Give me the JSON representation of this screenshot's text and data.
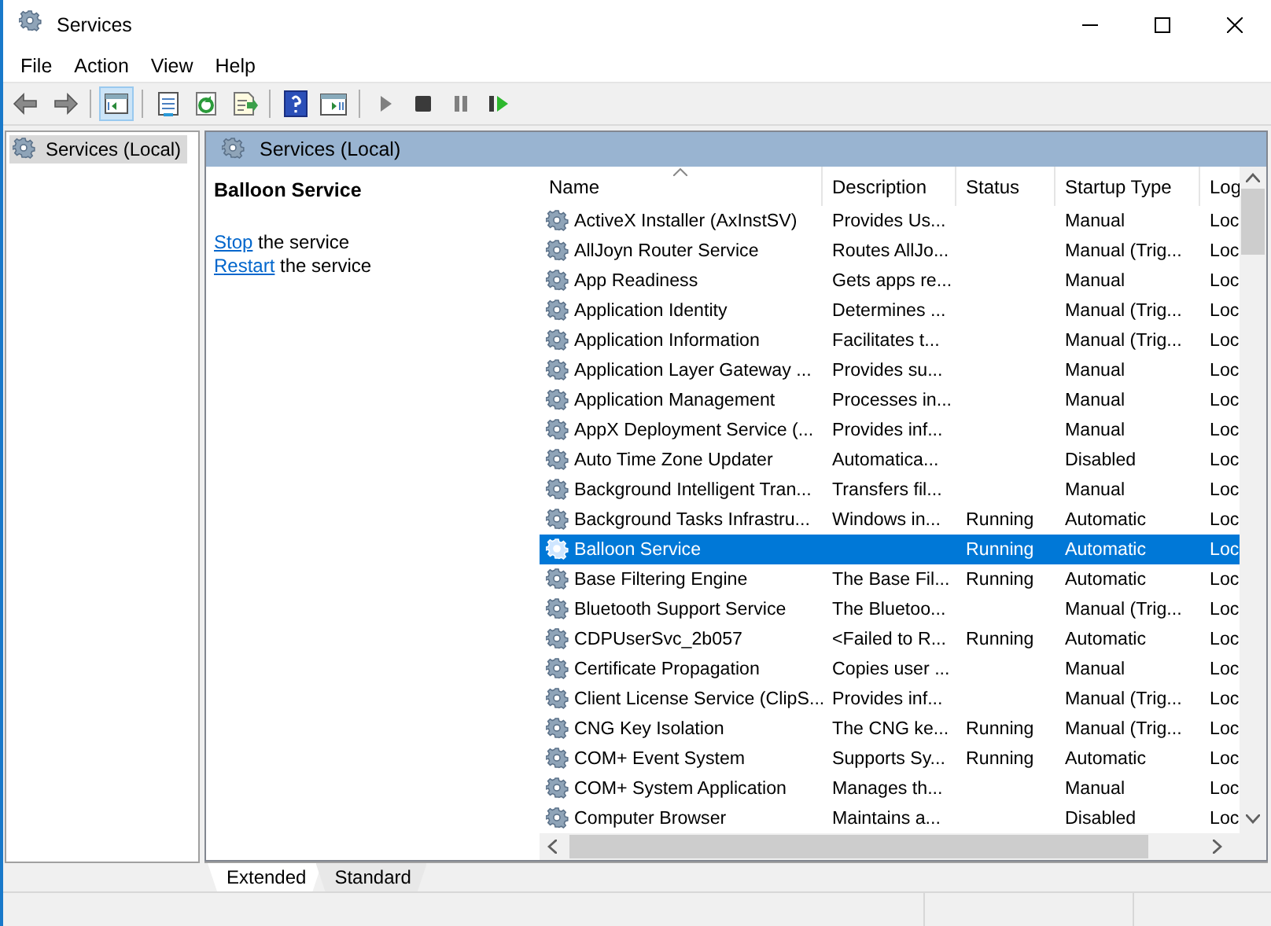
{
  "window": {
    "title": "Services"
  },
  "menu": [
    {
      "label": "File"
    },
    {
      "label": "Action"
    },
    {
      "label": "View"
    },
    {
      "label": "Help"
    }
  ],
  "toolbar": [
    {
      "kind": "back",
      "selected": false
    },
    {
      "kind": "forward",
      "selected": false
    },
    {
      "kind": "sep"
    },
    {
      "kind": "tree",
      "selected": true
    },
    {
      "kind": "sep"
    },
    {
      "kind": "properties",
      "selected": false
    },
    {
      "kind": "refresh",
      "selected": false
    },
    {
      "kind": "export",
      "selected": false
    },
    {
      "kind": "sep"
    },
    {
      "kind": "help",
      "selected": false
    },
    {
      "kind": "pane",
      "selected": false
    },
    {
      "kind": "sep"
    },
    {
      "kind": "play",
      "selected": false
    },
    {
      "kind": "stop",
      "selected": false
    },
    {
      "kind": "pause",
      "selected": false
    },
    {
      "kind": "resume",
      "selected": false
    }
  ],
  "tree": {
    "items": [
      {
        "label": "Services (Local)",
        "selected": true
      }
    ]
  },
  "panel": {
    "title": "Services (Local)"
  },
  "details": {
    "title": "Balloon Service",
    "actions": [
      {
        "link": "Stop",
        "text": "the service"
      },
      {
        "link": "Restart",
        "text": "the service"
      }
    ]
  },
  "table": {
    "columns": [
      "Name",
      "Description",
      "Status",
      "Startup Type",
      "Log"
    ],
    "rows": [
      {
        "name": "ActiveX Installer (AxInstSV)",
        "description": "Provides Us...",
        "startup": "Manual",
        "log": "Loc",
        "selected": false
      },
      {
        "name": "AllJoyn Router Service",
        "description": "Routes AllJo...",
        "startup": "Manual (Trig...",
        "log": "Loc",
        "selected": false
      },
      {
        "name": "App Readiness",
        "description": "Gets apps re...",
        "startup": "Manual",
        "log": "Loc",
        "selected": false
      },
      {
        "name": "Application Identity",
        "description": "Determines ...",
        "startup": "Manual (Trig...",
        "log": "Loc",
        "selected": false
      },
      {
        "name": "Application Information",
        "description": "Facilitates t...",
        "startup": "Manual (Trig...",
        "log": "Loc",
        "selected": false
      },
      {
        "name": "Application Layer Gateway ...",
        "description": "Provides su...",
        "startup": "Manual",
        "log": "Loc",
        "selected": false
      },
      {
        "name": "Application Management",
        "description": "Processes in...",
        "startup": "Manual",
        "log": "Loc",
        "selected": false
      },
      {
        "name": "AppX Deployment Service (...",
        "description": "Provides inf...",
        "startup": "Manual",
        "log": "Loc",
        "selected": false
      },
      {
        "name": "Auto Time Zone Updater",
        "description": "Automatica...",
        "startup": "Disabled",
        "log": "Loc",
        "selected": false
      },
      {
        "name": "Background Intelligent Tran...",
        "description": "Transfers fil...",
        "startup": "Manual",
        "log": "Loc",
        "selected": false
      },
      {
        "name": "Background Tasks Infrastru...",
        "description": "Windows in...",
        "status": "Running",
        "startup": "Automatic",
        "log": "Loc",
        "selected": false
      },
      {
        "name": "Balloon Service",
        "status": "Running",
        "startup": "Automatic",
        "log": "Loc",
        "selected": true
      },
      {
        "name": "Base Filtering Engine",
        "description": "The Base Fil...",
        "status": "Running",
        "startup": "Automatic",
        "log": "Loc",
        "selected": false
      },
      {
        "name": "Bluetooth Support Service",
        "description": "The Bluetoo...",
        "startup": "Manual (Trig...",
        "log": "Loc",
        "selected": false
      },
      {
        "name": "CDPUserSvc_2b057",
        "description": "<Failed to R...",
        "status": "Running",
        "startup": "Automatic",
        "log": "Loc",
        "selected": false
      },
      {
        "name": "Certificate Propagation",
        "description": "Copies user ...",
        "startup": "Manual",
        "log": "Loc",
        "selected": false
      },
      {
        "name": "Client License Service (ClipS...",
        "description": "Provides inf...",
        "startup": "Manual (Trig...",
        "log": "Loc",
        "selected": false
      },
      {
        "name": "CNG Key Isolation",
        "description": "The CNG ke...",
        "status": "Running",
        "startup": "Manual (Trig...",
        "log": "Loc",
        "selected": false
      },
      {
        "name": "COM+ Event System",
        "description": "Supports Sy...",
        "status": "Running",
        "startup": "Automatic",
        "log": "Loc",
        "selected": false
      },
      {
        "name": "COM+ System Application",
        "description": "Manages th...",
        "startup": "Manual",
        "log": "Loc",
        "selected": false
      },
      {
        "name": "Computer Browser",
        "description": "Maintains a...",
        "startup": "Disabled",
        "log": "Loc",
        "selected": false
      }
    ]
  },
  "view_tabs": [
    {
      "label": "Extended",
      "selected": true
    },
    {
      "label": "Standard",
      "selected": false
    }
  ]
}
